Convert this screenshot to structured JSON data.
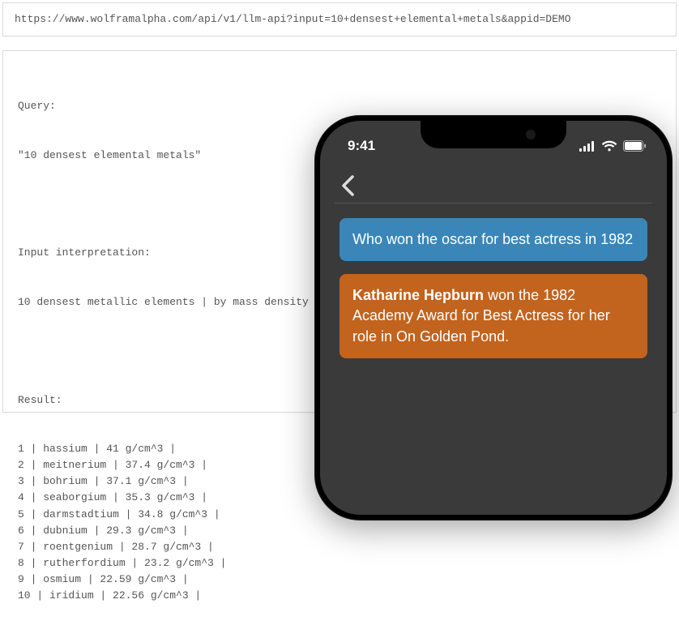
{
  "url": "https://www.wolframalpha.com/api/v1/llm-api?input=10+densest+elemental+metals&appid=DEMO",
  "api": {
    "query_label": "Query:",
    "query_value": "\"10 densest elemental metals\"",
    "interp_label": "Input interpretation:",
    "interp_value": "10 densest metallic elements | by mass density",
    "result_label": "Result:",
    "rows": [
      {
        "n": "1",
        "name": "hassium",
        "density": "41 g/cm^3"
      },
      {
        "n": "2",
        "name": "meitnerium",
        "density": "37.4 g/cm^3"
      },
      {
        "n": "3",
        "name": "bohrium",
        "density": "37.1 g/cm^3"
      },
      {
        "n": "4",
        "name": "seaborgium",
        "density": "35.3 g/cm^3"
      },
      {
        "n": "5",
        "name": "darmstadtium",
        "density": "34.8 g/cm^3"
      },
      {
        "n": "6",
        "name": "dubnium",
        "density": "29.3 g/cm^3"
      },
      {
        "n": "7",
        "name": "roentgenium",
        "density": "28.7 g/cm^3"
      },
      {
        "n": "8",
        "name": "rutherfordium",
        "density": "23.2 g/cm^3"
      },
      {
        "n": "9",
        "name": "osmium",
        "density": "22.59 g/cm^3"
      },
      {
        "n": "10",
        "name": "iridium",
        "density": "22.56 g/cm^3"
      }
    ]
  },
  "phone": {
    "time": "9:41",
    "chat": {
      "user_msg": "Who won the oscar for best actress in 1982",
      "bot_bold": "Katharine Hepburn",
      "bot_rest": " won the 1982 Academy Award for Best Actress for her role in On Golden Pond."
    }
  }
}
